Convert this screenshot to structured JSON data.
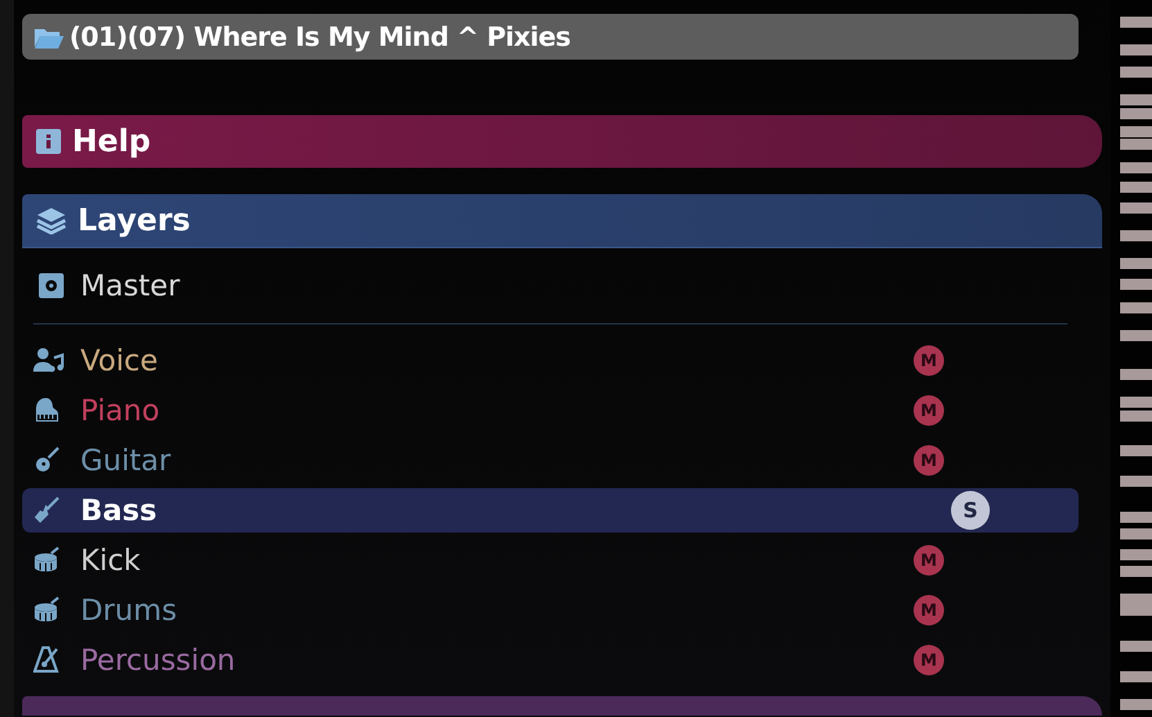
{
  "current_file": {
    "title": "(01)(07) Where Is My Mind ^ Pixies"
  },
  "help": {
    "title": "Help"
  },
  "layers": {
    "title": "Layers",
    "master": {
      "name": "Master"
    },
    "items": [
      {
        "name": "Voice",
        "kind": "voice",
        "color": "#c9a97f",
        "selected": false,
        "badge": {
          "kind": "mute",
          "label": "M"
        }
      },
      {
        "name": "Piano",
        "kind": "piano",
        "color": "#c2405e",
        "selected": false,
        "badge": {
          "kind": "mute",
          "label": "M"
        }
      },
      {
        "name": "Guitar",
        "kind": "guitar",
        "color": "#6d8fa8",
        "selected": false,
        "badge": {
          "kind": "mute",
          "label": "M"
        }
      },
      {
        "name": "Bass",
        "kind": "bass",
        "color": "#ffffff",
        "selected": true,
        "badge": {
          "kind": "solo",
          "label": "S"
        }
      },
      {
        "name": "Kick",
        "kind": "drum",
        "color": "#cfcfcf",
        "selected": false,
        "badge": {
          "kind": "mute",
          "label": "M"
        }
      },
      {
        "name": "Drums",
        "kind": "drum",
        "color": "#6d8fa8",
        "selected": false,
        "badge": {
          "kind": "mute",
          "label": "M"
        }
      },
      {
        "name": "Percussion",
        "kind": "metronome",
        "color": "#9a6aa0",
        "selected": false,
        "badge": {
          "kind": "mute",
          "label": "M"
        }
      }
    ]
  }
}
